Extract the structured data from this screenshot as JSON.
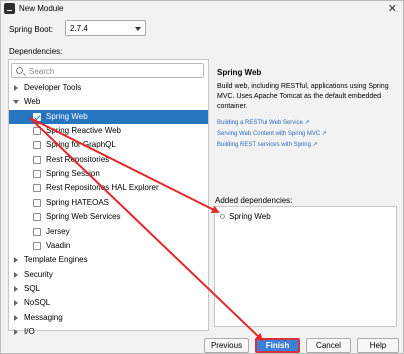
{
  "window": {
    "title": "New Module",
    "close_glyph": "✕"
  },
  "spring_boot": {
    "label": "Spring Boot:",
    "value": "2.7.4"
  },
  "dependencies_label": "Dependencies:",
  "search": {
    "placeholder": "Search"
  },
  "tree": [
    {
      "label": "Developer Tools",
      "type": "category",
      "expanded": false
    },
    {
      "label": "Web",
      "type": "category",
      "expanded": true
    },
    {
      "label": "Spring Web",
      "type": "item",
      "checked": true,
      "selected": true
    },
    {
      "label": "Spring Reactive Web",
      "type": "item",
      "checked": false
    },
    {
      "label": "Spring for GraphQL",
      "type": "item",
      "checked": false
    },
    {
      "label": "Rest Repositories",
      "type": "item",
      "checked": false
    },
    {
      "label": "Spring Session",
      "type": "item",
      "checked": false
    },
    {
      "label": "Rest Repositories HAL Explorer",
      "type": "item",
      "checked": false
    },
    {
      "label": "Spring HATEOAS",
      "type": "item",
      "checked": false
    },
    {
      "label": "Spring Web Services",
      "type": "item",
      "checked": false
    },
    {
      "label": "Jersey",
      "type": "item",
      "checked": false
    },
    {
      "label": "Vaadin",
      "type": "item",
      "checked": false
    },
    {
      "label": "Template Engines",
      "type": "category",
      "expanded": false
    },
    {
      "label": "Security",
      "type": "category",
      "expanded": false
    },
    {
      "label": "SQL",
      "type": "category",
      "expanded": false
    },
    {
      "label": "NoSQL",
      "type": "category",
      "expanded": false
    },
    {
      "label": "Messaging",
      "type": "category",
      "expanded": false
    },
    {
      "label": "I/O",
      "type": "category",
      "expanded": false
    }
  ],
  "detail": {
    "title": "Spring Web",
    "description": "Build web, including RESTful, applications using Spring MVC. Uses Apache Tomcat as the default embedded container.",
    "links": [
      "Building a RESTful Web Service ↗",
      "Serving Web Content with Spring MVC ↗",
      "Building REST services with Spring ↗"
    ]
  },
  "added": {
    "label": "Added dependencies:",
    "items": [
      "Spring Web"
    ]
  },
  "buttons": {
    "previous": "Previous",
    "finish": "Finish",
    "cancel": "Cancel",
    "help": "Help"
  },
  "colors": {
    "selection": "#2675bf",
    "link": "#2a6dc0",
    "annotation": "#e0282e",
    "primary_button": "#3c7fd6"
  }
}
